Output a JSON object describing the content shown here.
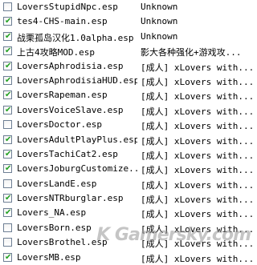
{
  "plugins": [
    {
      "name": "LoversStupidNpc.esp",
      "desc": "Unknown",
      "checked": false
    },
    {
      "name": "tes4-CHS-main.esp",
      "desc": "Unknown",
      "checked": true
    },
    {
      "name": "战栗孤岛汉化1.0alpha.esp",
      "desc": "Unknown",
      "checked": true
    },
    {
      "name": "上古4攻略MOD.esp",
      "desc": "影大各种强化+游戏攻...",
      "checked": true
    },
    {
      "name": "LoversAphrodisia.esp",
      "desc": "[成人] xLovers with...",
      "checked": true
    },
    {
      "name": "LoversAphrodisiaHUD.esp",
      "desc": "[成人] xLovers with...",
      "checked": true
    },
    {
      "name": "LoversRapeman.esp",
      "desc": "[成人] xLovers with...",
      "checked": true
    },
    {
      "name": "LoversVoiceSlave.esp",
      "desc": "[成人] xLovers with...",
      "checked": true
    },
    {
      "name": "LoversDoctor.esp",
      "desc": "[成人] xLovers with...",
      "checked": false
    },
    {
      "name": "LoversAdultPlayPlus.esp",
      "desc": "[成人] xLovers with...",
      "checked": true
    },
    {
      "name": "LoversTachiCat2.esp",
      "desc": "[成人] xLovers with...",
      "checked": true
    },
    {
      "name": "LoversJoburgCustomize...",
      "desc": "[成人] xLovers with...",
      "checked": true
    },
    {
      "name": "LoversLandE.esp",
      "desc": "[成人] xLovers with...",
      "checked": false
    },
    {
      "name": "LoversNTRburglar.esp",
      "desc": "[成人] xLovers with...",
      "checked": true
    },
    {
      "name": "Lovers_NA.esp",
      "desc": "[成人] xLovers with...",
      "checked": true
    },
    {
      "name": "LoversBorn.esp",
      "desc": "[成人] xLovers with...",
      "checked": false
    },
    {
      "name": "LoversBrothel.esp",
      "desc": "[成人] xLovers with...",
      "checked": false
    },
    {
      "name": "LoversMB.esp",
      "desc": "[成人] xLovers with...",
      "checked": true
    }
  ],
  "watermark": "K Gamersky.com"
}
